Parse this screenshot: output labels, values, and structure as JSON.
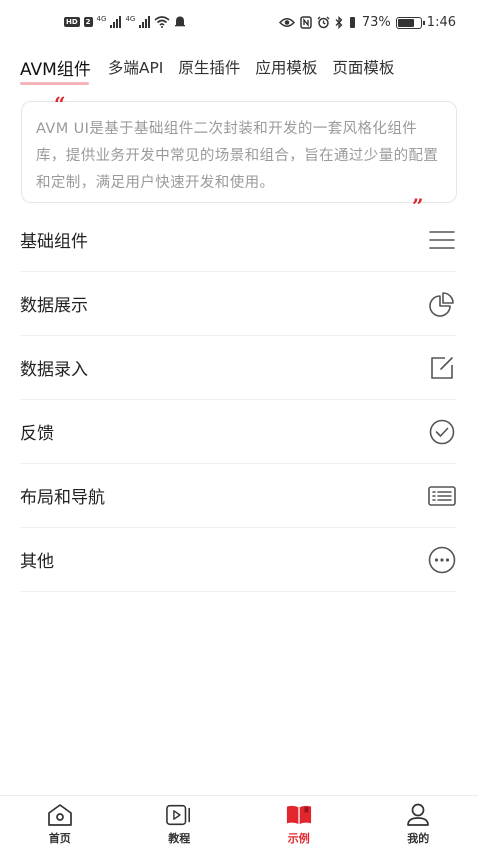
{
  "status_bar": {
    "hd": "HD",
    "sim": "2",
    "net1": "4G",
    "net2": "4G",
    "battery": "73%",
    "time": "1:46"
  },
  "top_tabs": [
    {
      "label": "AVM组件",
      "active": true
    },
    {
      "label": "多端API",
      "active": false
    },
    {
      "label": "原生插件",
      "active": false
    },
    {
      "label": "应用模板",
      "active": false
    },
    {
      "label": "页面模板",
      "active": false
    }
  ],
  "description": {
    "open_quote": "“",
    "close_quote": "”",
    "text": "AVM UI是基于基础组件二次封装和开发的一套风格化组件库，提供业务开发中常见的场景和组合，旨在通过少量的配置和定制，满足用户快速开发和使用。"
  },
  "list": [
    {
      "label": "基础组件",
      "icon": "menu-icon"
    },
    {
      "label": "数据展示",
      "icon": "pie-chart-icon"
    },
    {
      "label": "数据录入",
      "icon": "edit-icon"
    },
    {
      "label": "反馈",
      "icon": "check-circle-icon"
    },
    {
      "label": "布局和导航",
      "icon": "layout-list-icon"
    },
    {
      "label": "其他",
      "icon": "more-circle-icon"
    }
  ],
  "bottom_nav": [
    {
      "label": "首页",
      "icon": "home-icon",
      "active": false
    },
    {
      "label": "教程",
      "icon": "video-icon",
      "active": false
    },
    {
      "label": "示例",
      "icon": "book-icon",
      "active": true
    },
    {
      "label": "我的",
      "icon": "user-icon",
      "active": false
    }
  ],
  "colors": {
    "accent": "#e1262e",
    "tab_underline": "#f4b4b8",
    "desc_text": "#9a9a9a",
    "icon_gray": "#555555"
  }
}
